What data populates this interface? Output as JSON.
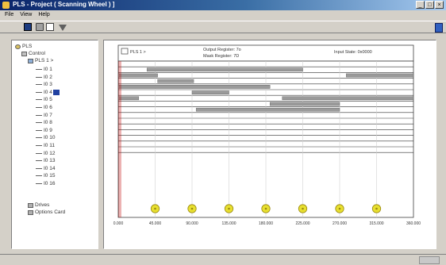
{
  "window": {
    "title": "PLS - Project ( Scanning Wheel ) ]"
  },
  "menu": [
    "File",
    "View",
    "Help"
  ],
  "tree": {
    "root": "PLS",
    "control": "Control",
    "plc": "PLS 1 >",
    "inputs": [
      "I0 1",
      "I0 2",
      "I0 3",
      "I0 4",
      "I0 5",
      "I0 6",
      "I0 7",
      "I0 8",
      "I0 9",
      "I0 10",
      "I0 11",
      "I0 12",
      "I0 13",
      "I0 14",
      "I0 15",
      "I0 16"
    ],
    "selected_index": 3,
    "drives": "Drives",
    "options": "Options Card"
  },
  "chart_header": {
    "device": "PLS 1 >",
    "output_register": "Output Register: 7o",
    "mask_register": "Mask Register: 7D",
    "input_state": "Input State: 0x0000"
  },
  "chart_data": {
    "type": "timeline",
    "x_ticks": [
      "0.000",
      "45.000",
      "90.000",
      "135.000",
      "180.000",
      "225.000",
      "270.000",
      "315.000",
      "360.000"
    ],
    "xlim": [
      0,
      360
    ],
    "markers": [
      45,
      90,
      135,
      180,
      225,
      270,
      315
    ],
    "channels": [
      {
        "segments": []
      },
      {
        "segments": [
          [
            35,
            225
          ]
        ]
      },
      {
        "segments": [
          [
            0,
            48
          ],
          [
            278,
            360
          ]
        ]
      },
      {
        "segments": [
          [
            48,
            92
          ]
        ]
      },
      {
        "segments": [
          [
            0,
            185
          ]
        ]
      },
      {
        "segments": [
          [
            90,
            135
          ]
        ]
      },
      {
        "segments": [
          [
            0,
            25
          ],
          [
            200,
            360
          ]
        ]
      },
      {
        "segments": [
          [
            185,
            270
          ]
        ]
      },
      {
        "segments": [
          [
            95,
            270
          ]
        ]
      },
      {
        "segments": []
      },
      {
        "segments": []
      },
      {
        "segments": []
      },
      {
        "segments": []
      },
      {
        "segments": []
      },
      {
        "segments": []
      },
      {
        "segments": []
      }
    ]
  },
  "colors": {
    "segment": "#9a9a9a",
    "marker": "#e8e030",
    "redline": "#c00000",
    "selected": "#2040a0"
  }
}
